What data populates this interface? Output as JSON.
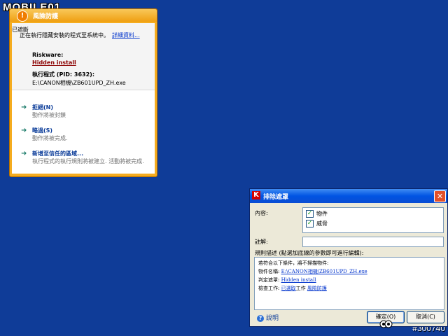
{
  "watermark": "MOBILE01",
  "corner_tag": "#300740",
  "alert": {
    "title": "風險防護",
    "status": "已遮斷",
    "message": "正在執行隱藏安裝的程式至系統中。",
    "details_link": "詳細資料...",
    "kind_label": "Riskware:",
    "kind_value": "Hidden install",
    "program_label": "執行程式 (PID: 3632):",
    "program_path": "E:\\CANON相機\\ZB601UPD_ZH.exe",
    "actions": [
      {
        "title": "拒絕(N)",
        "desc": "動作將被封鎖"
      },
      {
        "title": "略過(S)",
        "desc": "動作將被完成."
      },
      {
        "title": "新增至信任的區域...",
        "desc": "執行程式的執行規則將被建立. 活動將被完成."
      }
    ]
  },
  "dialog": {
    "title": "排除遮罩",
    "content_label": "內容:",
    "checkboxes": [
      {
        "label": "物件",
        "checked": true
      },
      {
        "label": "威脅",
        "checked": true
      }
    ],
    "note_label": "註解:",
    "note_value": "",
    "rule_label": "規則描述 (點選加底線的參數即可進行編輯):",
    "rule_intro": "若符合以下條件，將不掃描物件:",
    "rule_object_label": "物件名稱:",
    "rule_object_value": "E:\\CANON相機\\ZB601UPD_ZH.exe",
    "rule_threat_label": "判定遮罩:",
    "rule_threat_value": "Hidden install",
    "rule_task_label": "檢查工作:",
    "rule_task_value_a": "已選取",
    "rule_task_mid": "工作",
    "rule_task_value_b": "風險防護",
    "help": "說明",
    "ok": "確定(O)",
    "cancel": "取消(C)"
  }
}
